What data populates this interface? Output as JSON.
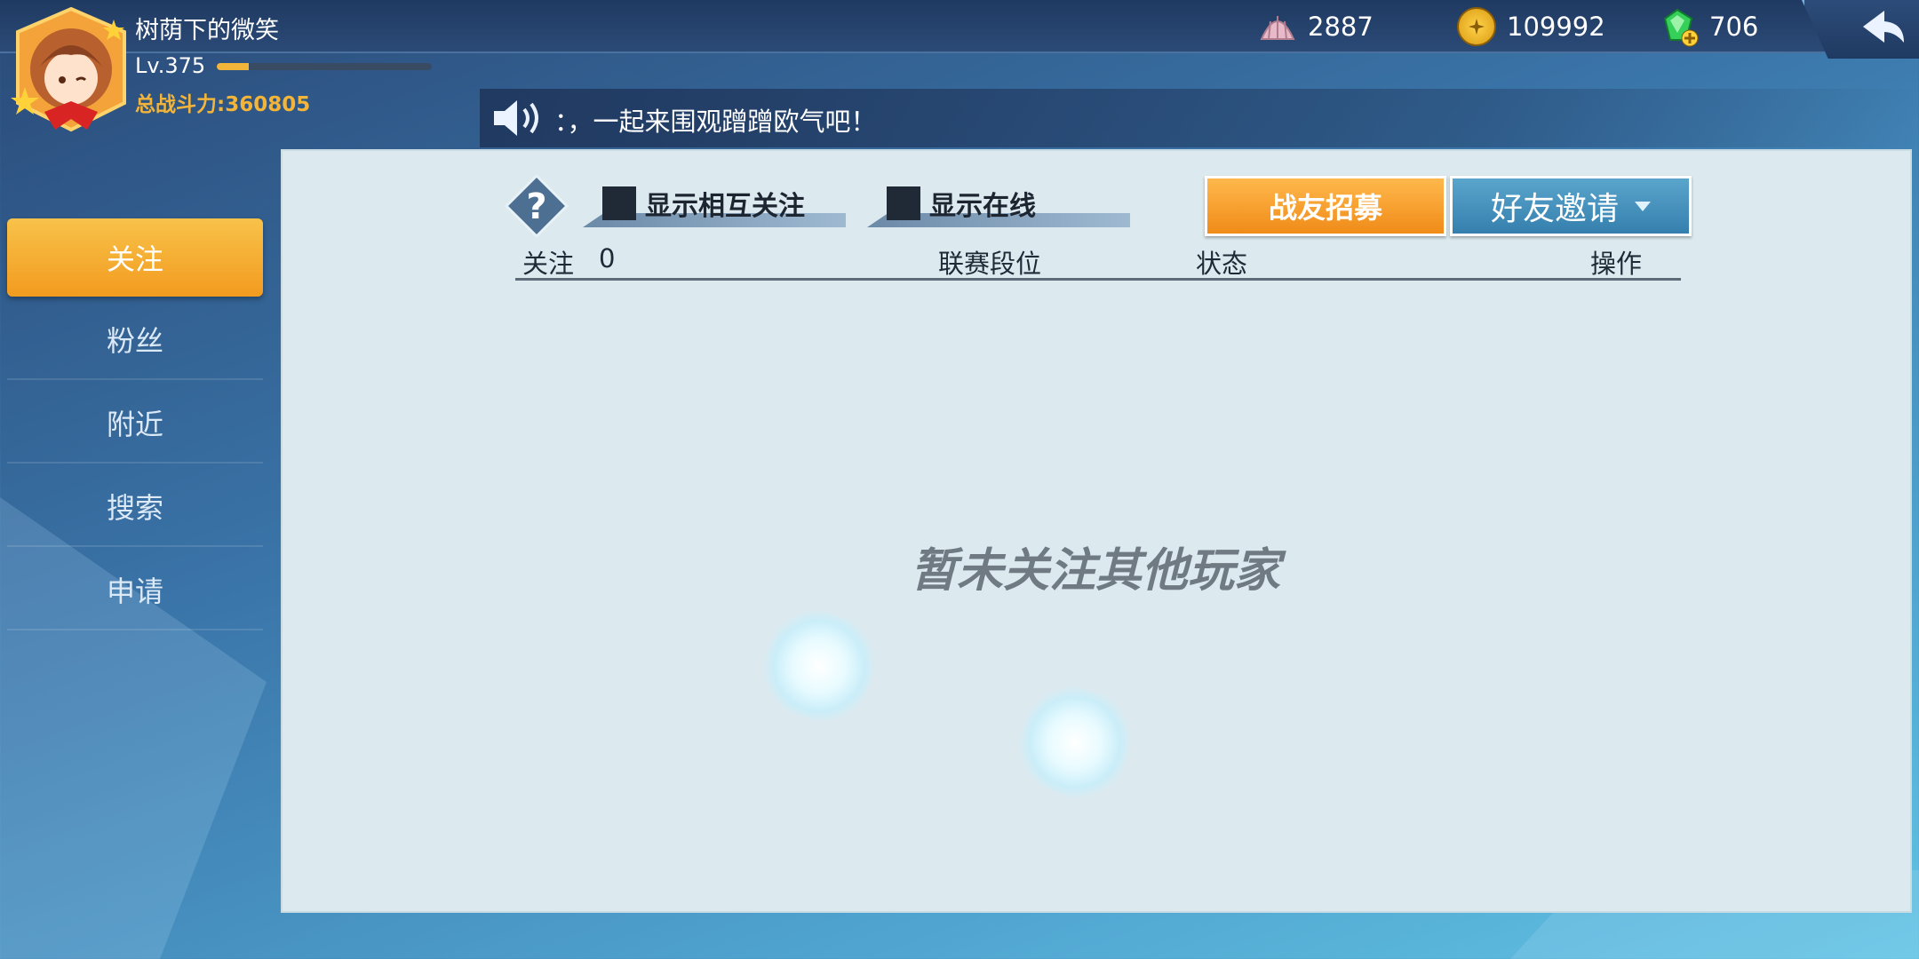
{
  "player": {
    "name": "树荫下的微笑",
    "level": "Lv.375",
    "level_progress": 0.15,
    "power": "总战斗力:360805"
  },
  "currencies": {
    "shell": "2887",
    "gold": "109992",
    "gem": "706"
  },
  "announcement": "：，一起来围观蹭蹭欧气吧！",
  "sidebar": {
    "items": [
      {
        "label": "关注"
      },
      {
        "label": "粉丝"
      },
      {
        "label": "附近"
      },
      {
        "label": "搜索"
      },
      {
        "label": "申请"
      }
    ]
  },
  "filters": {
    "mutual": "显示相互关注",
    "online": "显示在线"
  },
  "actions": {
    "recruit": "战友招募",
    "invite": "好友邀请"
  },
  "table": {
    "col_follow": "关注",
    "follow_count": "0",
    "col_rank": "联赛段位",
    "col_status": "状态",
    "col_action": "操作"
  },
  "empty_message": "暂未关注其他玩家"
}
